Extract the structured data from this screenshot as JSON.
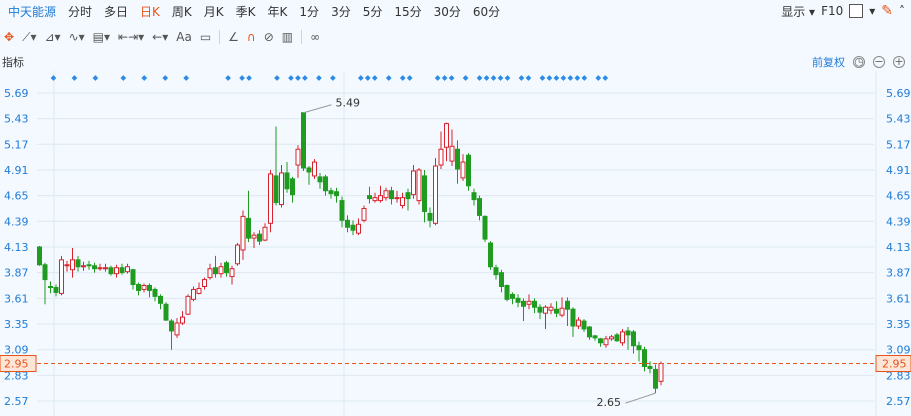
{
  "tabs": {
    "stock_name": "中天能源",
    "items": [
      "分时",
      "多日",
      "日K",
      "周K",
      "月K",
      "季K",
      "年K",
      "1分",
      "3分",
      "5分",
      "15分",
      "30分",
      "60分"
    ],
    "active": "日K"
  },
  "right_tools": {
    "display_label": "显示",
    "f10_label": "F10"
  },
  "toolbar": {
    "text_tool_label": "Aa"
  },
  "header": {
    "indicator_label": "指标",
    "adjust_label": "前复权"
  },
  "colors": {
    "up": "#d9232e",
    "down": "#1f9c1f",
    "accent": "#e8541a",
    "tick": "#1f7bd6",
    "marker": "#2b8be6"
  },
  "chart_data": {
    "type": "candlestick",
    "y_ticks": [
      5.69,
      5.43,
      5.17,
      4.91,
      4.65,
      4.39,
      4.13,
      3.87,
      3.61,
      3.35,
      3.09,
      2.83,
      2.57
    ],
    "ylim": [
      2.54,
      5.72
    ],
    "current_price": 2.95,
    "max_label": "5.49",
    "min_label": "2.65",
    "markers": [
      2,
      5,
      8,
      12,
      15,
      18,
      21,
      27,
      29,
      30,
      34,
      36,
      37,
      38,
      40,
      42,
      46,
      47,
      48,
      50,
      52,
      53,
      57,
      58,
      59,
      61,
      63,
      64,
      65,
      66,
      67,
      69,
      70,
      72,
      73,
      74,
      75,
      76,
      77,
      78,
      80,
      81
    ],
    "candles": [
      [
        4.13,
        3.95,
        4.14,
        3.94
      ],
      [
        3.95,
        3.8,
        3.97,
        3.55
      ],
      [
        3.73,
        3.72,
        3.78,
        3.66
      ],
      [
        3.72,
        3.67,
        3.75,
        3.63
      ],
      [
        3.66,
        4.0,
        4.04,
        3.64
      ],
      [
        3.94,
        3.95,
        3.99,
        3.88
      ],
      [
        3.9,
        4.0,
        4.12,
        3.82
      ],
      [
        4.0,
        3.93,
        4.04,
        3.88
      ],
      [
        3.93,
        3.94,
        3.98,
        3.89
      ],
      [
        3.95,
        3.94,
        3.99,
        3.9
      ],
      [
        3.94,
        3.91,
        3.97,
        3.87
      ],
      [
        3.91,
        3.92,
        3.96,
        3.89
      ],
      [
        3.92,
        3.92,
        3.96,
        3.88
      ],
      [
        3.92,
        3.86,
        3.94,
        3.84
      ],
      [
        3.86,
        3.92,
        3.95,
        3.82
      ],
      [
        3.92,
        3.87,
        3.96,
        3.85
      ],
      [
        3.88,
        3.93,
        3.96,
        3.86
      ],
      [
        3.9,
        3.75,
        3.91,
        3.7
      ],
      [
        3.75,
        3.69,
        3.77,
        3.64
      ],
      [
        3.7,
        3.74,
        3.76,
        3.67
      ],
      [
        3.74,
        3.69,
        3.76,
        3.62
      ],
      [
        3.7,
        3.63,
        3.72,
        3.58
      ],
      [
        3.63,
        3.56,
        3.65,
        3.5
      ],
      [
        3.55,
        3.39,
        3.57,
        3.38
      ],
      [
        3.38,
        3.28,
        3.4,
        3.09
      ],
      [
        3.24,
        3.36,
        3.41,
        3.21
      ],
      [
        3.36,
        3.42,
        3.48,
        3.34
      ],
      [
        3.45,
        3.63,
        3.65,
        3.44
      ],
      [
        3.6,
        3.7,
        3.73,
        3.58
      ],
      [
        3.66,
        3.71,
        3.77,
        3.65
      ],
      [
        3.73,
        3.8,
        3.82,
        3.7
      ],
      [
        3.82,
        3.91,
        3.96,
        3.8
      ],
      [
        3.92,
        3.86,
        4.04,
        3.82
      ],
      [
        3.86,
        3.93,
        3.97,
        3.82
      ],
      [
        3.97,
        3.87,
        3.99,
        3.83
      ],
      [
        3.83,
        3.91,
        3.94,
        3.75
      ],
      [
        3.96,
        4.15,
        4.17,
        3.94
      ],
      [
        4.1,
        4.44,
        4.5,
        4.0
      ],
      [
        4.42,
        4.22,
        4.7,
        4.18
      ],
      [
        4.22,
        4.25,
        4.28,
        4.12
      ],
      [
        4.26,
        4.19,
        4.3,
        4.15
      ],
      [
        4.2,
        4.33,
        4.37,
        4.19
      ],
      [
        4.37,
        4.87,
        4.91,
        4.28
      ],
      [
        4.85,
        4.58,
        5.35,
        4.55
      ],
      [
        4.56,
        4.88,
        4.96,
        4.53
      ],
      [
        4.88,
        4.72,
        4.99,
        4.68
      ],
      [
        4.82,
        4.66,
        4.84,
        4.58
      ],
      [
        4.96,
        5.12,
        5.16,
        4.83
      ],
      [
        5.49,
        4.93,
        5.49,
        4.9
      ],
      [
        4.93,
        4.89,
        4.95,
        4.76
      ],
      [
        4.85,
        4.99,
        5.02,
        4.82
      ],
      [
        4.84,
        4.79,
        4.88,
        4.72
      ],
      [
        4.84,
        4.7,
        4.86,
        4.65
      ],
      [
        4.7,
        4.67,
        4.73,
        4.62
      ],
      [
        4.69,
        4.65,
        4.73,
        4.58
      ],
      [
        4.6,
        4.4,
        4.64,
        4.33
      ],
      [
        4.4,
        4.33,
        4.45,
        4.28
      ],
      [
        4.35,
        4.3,
        4.4,
        4.25
      ],
      [
        4.27,
        4.36,
        4.42,
        4.25
      ],
      [
        4.4,
        4.52,
        4.55,
        4.38
      ],
      [
        4.65,
        4.62,
        4.74,
        4.57
      ],
      [
        4.6,
        4.63,
        4.68,
        4.58
      ],
      [
        4.6,
        4.65,
        4.75,
        4.58
      ],
      [
        4.63,
        4.7,
        4.73,
        4.6
      ],
      [
        4.7,
        4.62,
        4.74,
        4.56
      ],
      [
        4.62,
        4.63,
        4.7,
        4.58
      ],
      [
        4.55,
        4.63,
        4.68,
        4.52
      ],
      [
        4.68,
        4.62,
        4.72,
        4.5
      ],
      [
        4.66,
        4.9,
        4.96,
        4.62
      ],
      [
        4.6,
        4.91,
        4.93,
        4.56
      ],
      [
        4.85,
        4.49,
        4.91,
        4.38
      ],
      [
        4.47,
        4.4,
        4.53,
        4.33
      ],
      [
        4.37,
        4.95,
        5.03,
        4.35
      ],
      [
        4.96,
        5.12,
        5.3,
        4.92
      ],
      [
        5.14,
        5.38,
        5.39,
        5.0
      ],
      [
        5.0,
        5.15,
        5.32,
        4.95
      ],
      [
        5.12,
        4.92,
        5.21,
        4.77
      ],
      [
        4.83,
        4.99,
        5.07,
        4.8
      ],
      [
        5.06,
        4.75,
        5.08,
        4.7
      ],
      [
        4.68,
        4.61,
        4.72,
        4.55
      ],
      [
        4.62,
        4.45,
        4.65,
        4.4
      ],
      [
        4.44,
        4.21,
        4.45,
        4.18
      ],
      [
        4.17,
        3.93,
        4.19,
        3.9
      ],
      [
        3.92,
        3.85,
        3.95,
        3.8
      ],
      [
        3.87,
        3.73,
        3.9,
        3.67
      ],
      [
        3.74,
        3.6,
        3.75,
        3.58
      ],
      [
        3.65,
        3.61,
        3.67,
        3.55
      ],
      [
        3.61,
        3.57,
        3.65,
        3.52
      ],
      [
        3.58,
        3.53,
        3.61,
        3.38
      ],
      [
        3.55,
        3.58,
        3.65,
        3.5
      ],
      [
        3.58,
        3.52,
        3.61,
        3.46
      ],
      [
        3.52,
        3.47,
        3.55,
        3.4
      ],
      [
        3.46,
        3.52,
        3.54,
        3.3
      ],
      [
        3.49,
        3.52,
        3.56,
        3.45
      ],
      [
        3.5,
        3.46,
        3.58,
        3.42
      ],
      [
        3.44,
        3.51,
        3.62,
        3.42
      ],
      [
        3.58,
        3.5,
        3.62,
        3.33
      ],
      [
        3.5,
        3.33,
        3.52,
        3.22
      ],
      [
        3.33,
        3.39,
        3.42,
        3.3
      ],
      [
        3.38,
        3.3,
        3.4,
        3.27
      ],
      [
        3.32,
        3.22,
        3.33,
        3.19
      ],
      [
        3.23,
        3.21,
        3.24,
        3.18
      ],
      [
        3.2,
        3.16,
        3.21,
        3.12
      ],
      [
        3.14,
        3.2,
        3.23,
        3.11
      ],
      [
        3.2,
        3.22,
        3.24,
        3.18
      ],
      [
        3.24,
        3.18,
        3.26,
        3.17
      ],
      [
        3.16,
        3.27,
        3.3,
        3.13
      ],
      [
        3.28,
        3.24,
        3.32,
        3.09
      ],
      [
        3.27,
        3.13,
        3.29,
        3.05
      ],
      [
        3.13,
        3.09,
        3.17,
        2.97
      ],
      [
        3.09,
        2.92,
        3.12,
        2.87
      ],
      [
        2.92,
        2.9,
        2.97,
        2.85
      ],
      [
        2.89,
        2.7,
        2.94,
        2.65
      ],
      [
        2.77,
        2.95,
        2.97,
        2.73
      ]
    ]
  }
}
